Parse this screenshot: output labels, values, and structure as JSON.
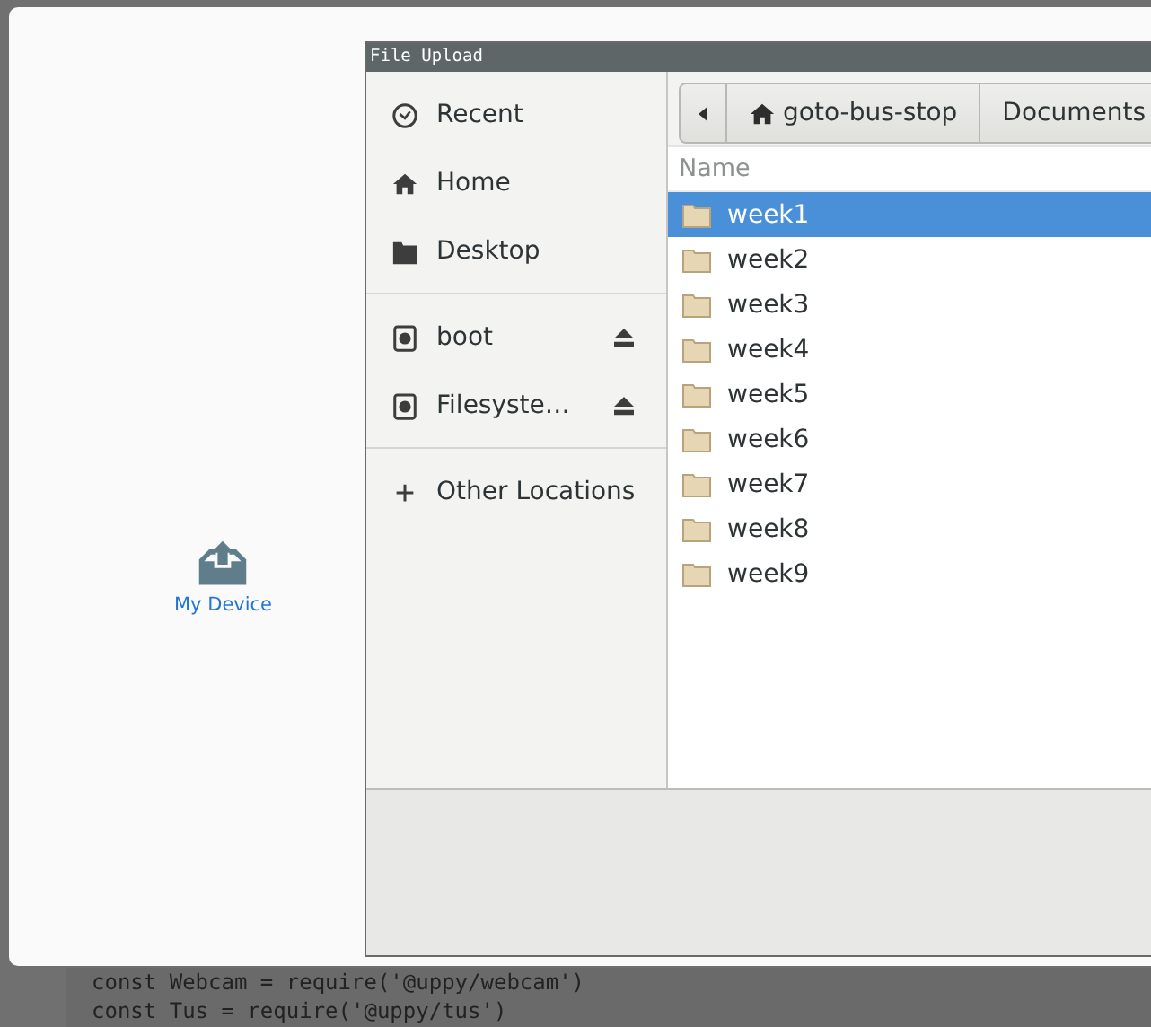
{
  "background_code": [
    "const Webcam = require('@uppy/webcam')",
    "const Tus = require('@uppy/tus')"
  ],
  "modal": {
    "sources": [
      {
        "kind": "device",
        "label": "My Device"
      }
    ]
  },
  "dialog": {
    "title": "File Upload",
    "sidebar": [
      [
        {
          "kind": "clock",
          "label": "Recent"
        },
        {
          "kind": "home",
          "label": "Home"
        },
        {
          "kind": "folder",
          "label": "Desktop"
        }
      ],
      [
        {
          "kind": "drive",
          "label": "boot",
          "eject": true
        },
        {
          "kind": "drive",
          "label": "Filesyste…",
          "eject": true
        }
      ],
      [
        {
          "kind": "plus",
          "label": "Other Locations"
        }
      ]
    ],
    "path": [
      {
        "kind": "home",
        "label": "goto-bus-stop"
      },
      {
        "kind": "plain",
        "label": "Documents"
      }
    ],
    "column": "Name",
    "rows": [
      {
        "name": "week1",
        "selected": true
      },
      {
        "name": "week2",
        "selected": false
      },
      {
        "name": "week3",
        "selected": false
      },
      {
        "name": "week4",
        "selected": false
      },
      {
        "name": "week5",
        "selected": false
      },
      {
        "name": "week6",
        "selected": false
      },
      {
        "name": "week7",
        "selected": false
      },
      {
        "name": "week8",
        "selected": false
      },
      {
        "name": "week9",
        "selected": false
      }
    ]
  }
}
